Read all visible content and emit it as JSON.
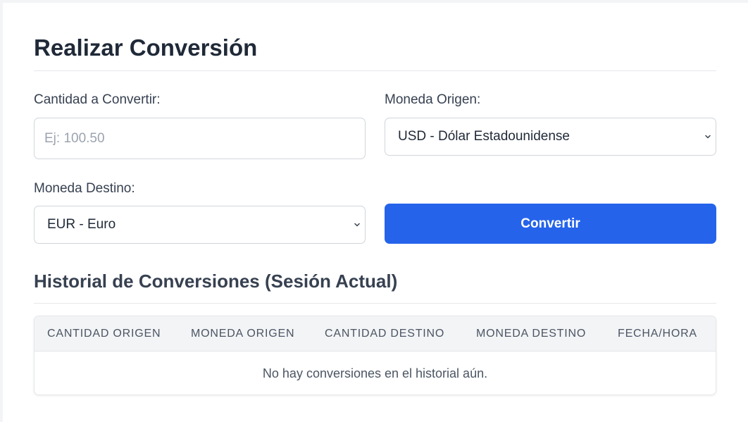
{
  "form": {
    "title": "Realizar Conversión",
    "amount_label": "Cantidad a Convertir:",
    "amount_placeholder": "Ej: 100.50",
    "amount_value": "",
    "origin_label": "Moneda Origen:",
    "origin_selected": "USD - Dólar Estadounidense",
    "destination_label": "Moneda Destino:",
    "destination_selected": "EUR - Euro",
    "convert_label": "Convertir"
  },
  "history": {
    "title": "Historial de Conversiones (Sesión Actual)",
    "columns": [
      "CANTIDAD ORIGEN",
      "MONEDA ORIGEN",
      "CANTIDAD DESTINO",
      "MONEDA DESTINO",
      "FECHA/HORA"
    ],
    "rows": [],
    "empty_message": "No hay conversiones en el historial aún."
  },
  "colors": {
    "accent": "#2563eb",
    "background": "#f3f4f6",
    "card": "#ffffff",
    "border": "#d1d5db"
  },
  "icons": {
    "select_chevron": "chevron-down-icon"
  }
}
